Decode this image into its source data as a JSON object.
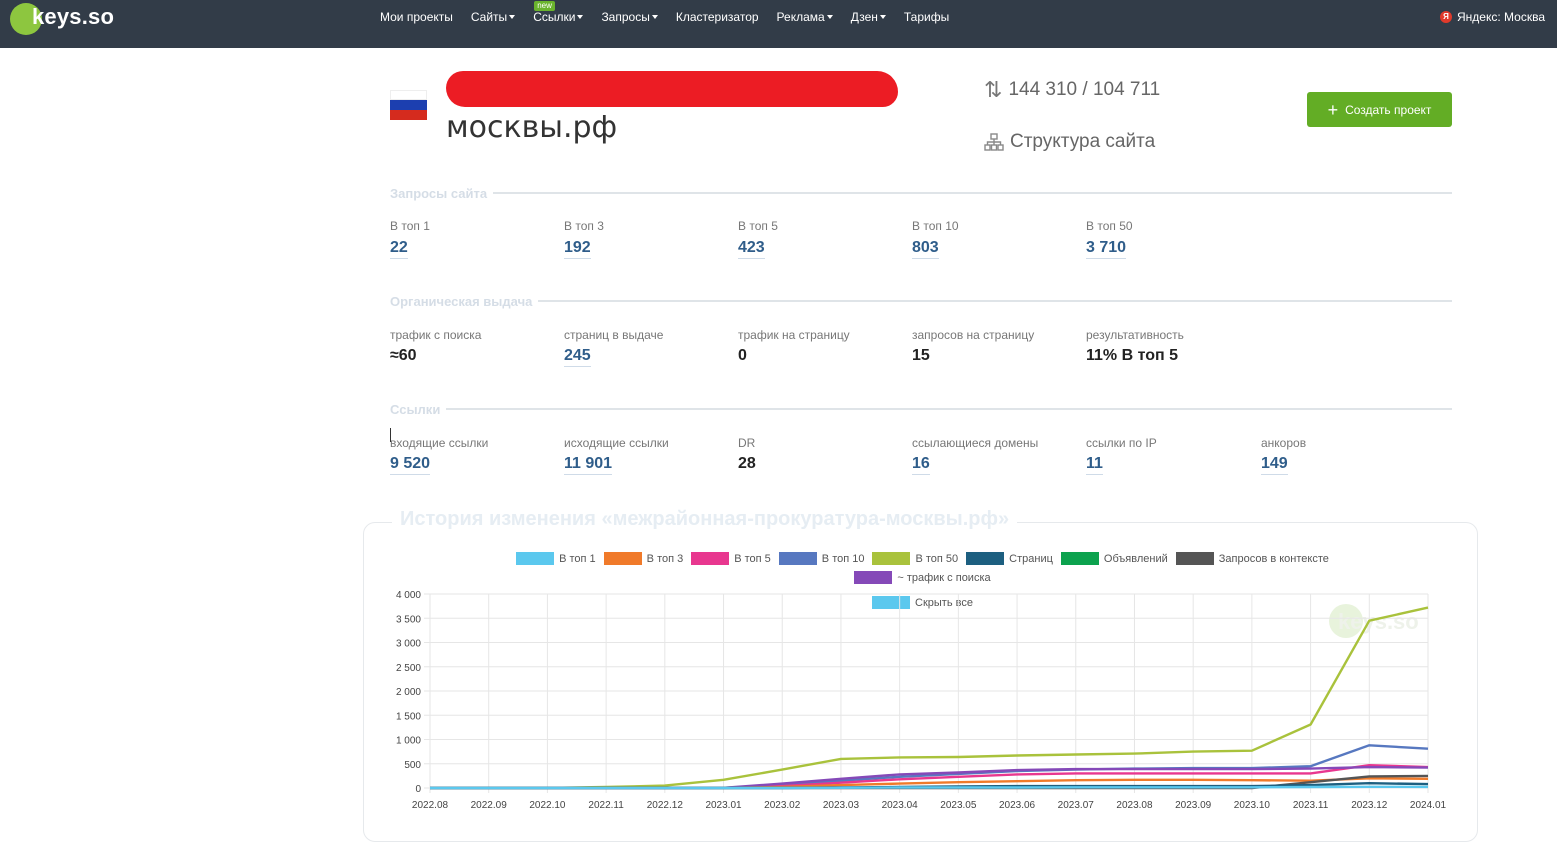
{
  "header": {
    "logo": "keys.so",
    "nav": [
      {
        "label": "Мои проекты",
        "dropdown": false,
        "badge": ""
      },
      {
        "label": "Сайты",
        "dropdown": true,
        "badge": ""
      },
      {
        "label": "Ссылки",
        "dropdown": true,
        "badge": "new"
      },
      {
        "label": "Запросы",
        "dropdown": true,
        "badge": ""
      },
      {
        "label": "Кластеризатор",
        "dropdown": false,
        "badge": ""
      },
      {
        "label": "Реклама",
        "dropdown": true,
        "badge": ""
      },
      {
        "label": "Дзен",
        "dropdown": true,
        "badge": ""
      },
      {
        "label": "Тарифы",
        "dropdown": false,
        "badge": ""
      }
    ],
    "region": "Яндекс: Москва",
    "region_icon": "Я"
  },
  "site": {
    "domain": "москвы.рф",
    "count": "144 310 / 104 711",
    "structure_label": "Структура сайта",
    "create_button": "Создать проект"
  },
  "sections": {
    "queries": {
      "title": "Запросы сайта",
      "metrics": [
        {
          "label": "В топ 1",
          "value": "22"
        },
        {
          "label": "В топ 3",
          "value": "192"
        },
        {
          "label": "В топ 5",
          "value": "423"
        },
        {
          "label": "В топ 10",
          "value": "803"
        },
        {
          "label": "В топ 50",
          "value": "3 710"
        }
      ]
    },
    "organic": {
      "title": "Органическая выдача",
      "metrics": [
        {
          "label": "трафик с поиска",
          "value": "≈60"
        },
        {
          "label": "страниц в выдаче",
          "value": "245"
        },
        {
          "label": "трафик на страницу",
          "value": "0"
        },
        {
          "label": "запросов на страницу",
          "value": "15"
        },
        {
          "label": "результативность",
          "value": "11% В топ 5"
        }
      ]
    },
    "links": {
      "title": "Ссылки",
      "metrics": [
        {
          "label": "входящие ссылки",
          "value": "9 520"
        },
        {
          "label": "исходящие ссылки",
          "value": "11 901"
        },
        {
          "label": "DR",
          "value": "28"
        },
        {
          "label": "ссылающиеся домены",
          "value": "16"
        },
        {
          "label": "ссылки по IP",
          "value": "11"
        },
        {
          "label": "анкоров",
          "value": "149"
        }
      ]
    }
  },
  "history": {
    "title": "История изменения «межрайонная-прокуратура-москвы.рф»"
  },
  "chart_data": {
    "type": "line",
    "watermark": "keys.so",
    "x": [
      "2022.08",
      "2022.09",
      "2022.10",
      "2022.11",
      "2022.12",
      "2023.01",
      "2023.02",
      "2023.03",
      "2023.04",
      "2023.05",
      "2023.06",
      "2023.07",
      "2023.08",
      "2023.09",
      "2023.10",
      "2023.11",
      "2023.12",
      "2024.01"
    ],
    "ylim": [
      0,
      4000
    ],
    "yticks": [
      "0",
      "500",
      "1 000",
      "1 500",
      "2 000",
      "2 500",
      "3 000",
      "3 500",
      "4 000"
    ],
    "grid": true,
    "legend": [
      {
        "name": "В топ 1",
        "color": "#5bc8ee"
      },
      {
        "name": "В топ 3",
        "color": "#f07a2a"
      },
      {
        "name": "В топ 5",
        "color": "#e8378f"
      },
      {
        "name": "В топ 10",
        "color": "#5778c0"
      },
      {
        "name": "В топ 50",
        "color": "#a9c23c"
      },
      {
        "name": "Страниц",
        "color": "#1d5f80"
      },
      {
        "name": "Объявлений",
        "color": "#0ca24e"
      },
      {
        "name": "Запросов в контексте",
        "color": "#555555"
      },
      {
        "name": "~ трафик с поиска",
        "color": "#8549b8"
      },
      {
        "name": "Скрыть все",
        "color": "#5bc8ee"
      }
    ],
    "series": [
      {
        "name": "В топ 50",
        "color": "#a9c23c",
        "values": [
          0,
          0,
          0,
          20,
          50,
          170,
          380,
          600,
          630,
          640,
          670,
          690,
          710,
          750,
          770,
          1310,
          3450,
          3720
        ]
      },
      {
        "name": "В топ 10",
        "color": "#5778c0",
        "values": [
          0,
          0,
          0,
          0,
          0,
          5,
          60,
          150,
          230,
          290,
          350,
          380,
          400,
          410,
          410,
          450,
          880,
          810
        ]
      },
      {
        "name": "В топ 5",
        "color": "#e8378f",
        "values": [
          0,
          0,
          0,
          0,
          0,
          5,
          40,
          110,
          180,
          230,
          280,
          300,
          300,
          300,
          300,
          300,
          470,
          430
        ]
      },
      {
        "name": "~ трафик с поиска",
        "color": "#8549b8",
        "values": [
          0,
          0,
          0,
          0,
          0,
          5,
          90,
          190,
          280,
          320,
          370,
          390,
          390,
          390,
          390,
          400,
          430,
          420
        ]
      },
      {
        "name": "В топ 3",
        "color": "#f07a2a",
        "values": [
          0,
          0,
          0,
          0,
          0,
          0,
          20,
          60,
          90,
          120,
          140,
          160,
          170,
          170,
          160,
          150,
          200,
          190
        ]
      },
      {
        "name": "Запросов в контексте",
        "color": "#555555",
        "values": [
          0,
          0,
          0,
          0,
          0,
          0,
          0,
          0,
          0,
          0,
          0,
          0,
          0,
          0,
          0,
          120,
          240,
          250
        ]
      },
      {
        "name": "Страниц",
        "color": "#1d5f80",
        "values": [
          0,
          0,
          0,
          0,
          0,
          0,
          0,
          10,
          20,
          30,
          40,
          40,
          40,
          40,
          40,
          60,
          100,
          80
        ]
      },
      {
        "name": "В топ 1",
        "color": "#5bc8ee",
        "values": [
          0,
          0,
          0,
          0,
          0,
          0,
          0,
          5,
          10,
          10,
          10,
          15,
          15,
          15,
          15,
          20,
          25,
          22
        ]
      }
    ]
  }
}
